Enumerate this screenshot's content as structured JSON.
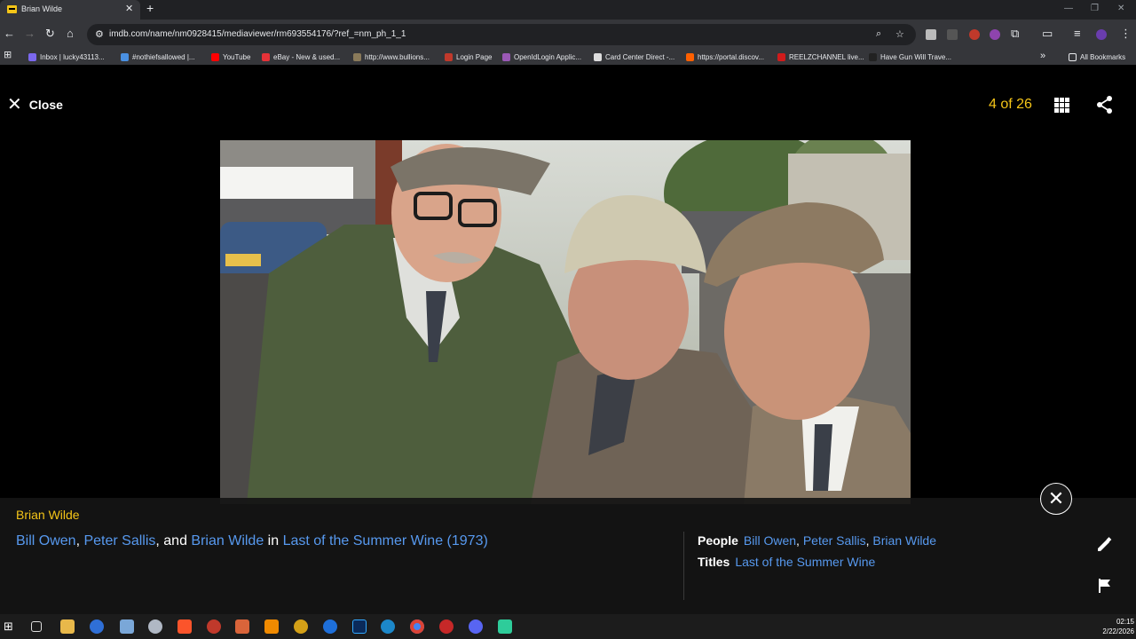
{
  "browser": {
    "tab_title": "Brian Wilde",
    "new_tab": "+",
    "url": "imdb.com/name/nm0928415/mediaviewer/rm693554176/?ref_=nm_ph_1_1",
    "bookmarks": [
      {
        "label": "Inbox | lucky43113...",
        "color": "#7b68ee"
      },
      {
        "label": "#nothiefsallowed |...",
        "color": "#4a90e2"
      },
      {
        "label": "YouTube",
        "color": "#ff0000"
      },
      {
        "label": "eBay - New & used...",
        "color": "#e53238"
      },
      {
        "label": "http://www.bullions...",
        "color": "#8a7a5a"
      },
      {
        "label": "Login Page",
        "color": "#c0392b"
      },
      {
        "label": "OpenIdLogin Applic...",
        "color": "#9b59b6"
      },
      {
        "label": "Card Center Direct -...",
        "color": "#dddddd"
      },
      {
        "label": "https://portal.discov...",
        "color": "#ff6000"
      },
      {
        "label": "REELZCHANNEL live...",
        "color": "#d01b1b"
      },
      {
        "label": "Have Gun Will Trave...",
        "color": "#222222"
      }
    ],
    "all_bookmarks": "All Bookmarks"
  },
  "viewer": {
    "close_label": "Close",
    "counter": "4 of 26"
  },
  "caption": {
    "name": "Brian Wilde",
    "people": [
      "Bill Owen",
      "Peter Sallis",
      "Brian Wilde"
    ],
    "sep1": ", ",
    "sep2": ", and ",
    "in_text": " in ",
    "title": "Last of the Summer Wine (1973)",
    "people_label": "People",
    "comma": ", ",
    "titles_label": "Titles",
    "titles_value": "Last of the Summer Wine"
  },
  "taskbar": {
    "time": "02:15",
    "date": "2/22/2026"
  },
  "colors": {
    "imdb_yellow": "#f5c518",
    "link_blue": "#5799ef"
  }
}
